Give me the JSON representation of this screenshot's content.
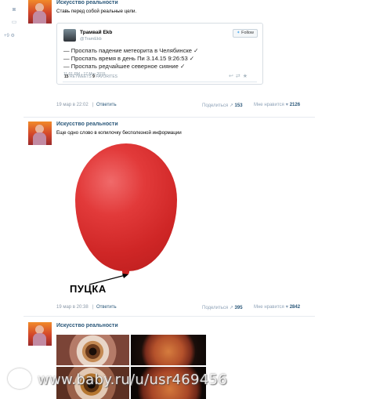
{
  "left_rail": {
    "icons": [
      "camera-icon",
      "comment-icon",
      "gear-icon"
    ],
    "counter": "+9"
  },
  "posts": [
    {
      "author": "Искусство реальности",
      "text": "Ставь перед собой реальные цели.",
      "tweet": {
        "name": "Трамвай Ekb",
        "handle": "@TramEkb",
        "follow_label": "Follow",
        "lines": [
          "— Проспать падение метеорита в Челябинске ✓",
          "— Проспать время в день Пи 3.14.15 9:26:53 ✓",
          "— Проспать редчайшее северное сияние ✓"
        ],
        "date": "11:01 PM - 17 Mar 2015",
        "retweets": "15",
        "retweets_label": "RETWEETS",
        "favorites": "9",
        "favorites_label": "FAVORITES"
      },
      "date": "19 мар в 22:02",
      "reply_label": "Ответить",
      "share_label": "Поделиться",
      "share_count": "153",
      "like_label": "Мне нравится",
      "like_count": "2126"
    },
    {
      "author": "Искусство реальности",
      "text": "Еще одно слово в копилочку бесполезной информации",
      "image_label": "ПУЦКА",
      "date": "19 мар в 20:38",
      "reply_label": "Ответить",
      "share_label": "Поделиться",
      "share_count": "395",
      "like_label": "Мне нравится",
      "like_count": "2842"
    },
    {
      "author": "Искусство реальности"
    }
  ],
  "watermark": "www.baby.ru/u/usr469456"
}
